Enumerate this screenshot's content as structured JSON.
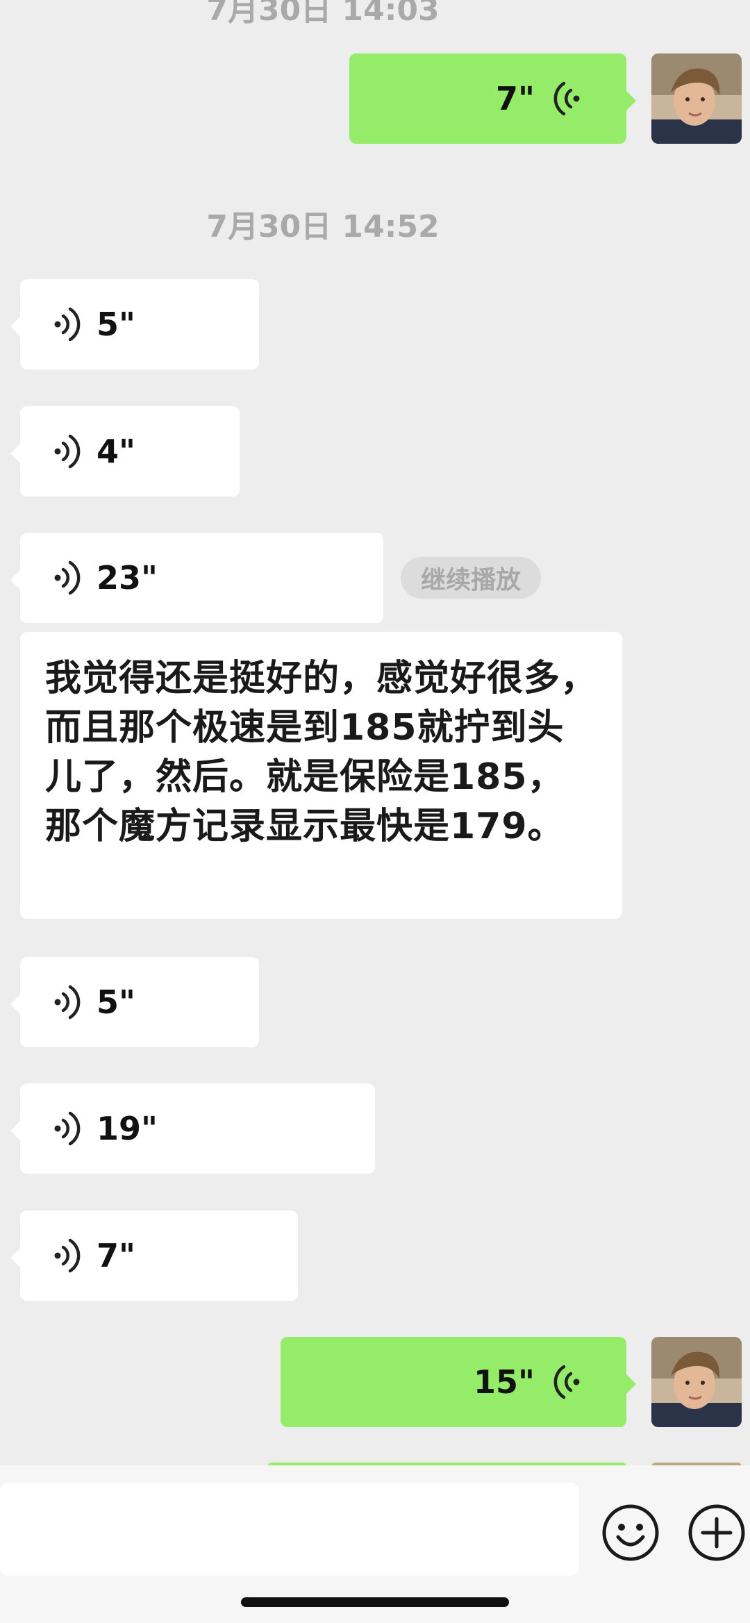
{
  "timestamps": {
    "top_partial": "7月30日 14:03",
    "middle": "7月30日 14:52"
  },
  "messages": {
    "sent_1": {
      "duration": "7\"",
      "icon": "voice-wave-icon"
    },
    "recv_1": {
      "duration": "5\"",
      "icon": "voice-wave-icon"
    },
    "recv_2": {
      "duration": "4\"",
      "icon": "voice-wave-icon"
    },
    "recv_3": {
      "duration": "23\"",
      "icon": "voice-wave-icon"
    },
    "resume_label": "继续播放",
    "text_1": "我觉得还是挺好的，感觉好很多，而且那个极速是到185就拧到头儿了，然后。就是保险是185，那个魔方记录显示最快是179。",
    "recv_4": {
      "duration": "5\"",
      "icon": "voice-wave-icon"
    },
    "recv_5": {
      "duration": "19\"",
      "icon": "voice-wave-icon"
    },
    "recv_6": {
      "duration": "7\"",
      "icon": "voice-wave-icon"
    },
    "sent_2": {
      "duration": "15\"",
      "icon": "voice-wave-icon"
    }
  },
  "input": {
    "value": "",
    "emoji_icon": "emoji-icon",
    "plus_icon": "plus-icon"
  },
  "colors": {
    "sent_bubble": "#95ec69",
    "received_bubble": "#ffffff",
    "background": "#ededed"
  }
}
